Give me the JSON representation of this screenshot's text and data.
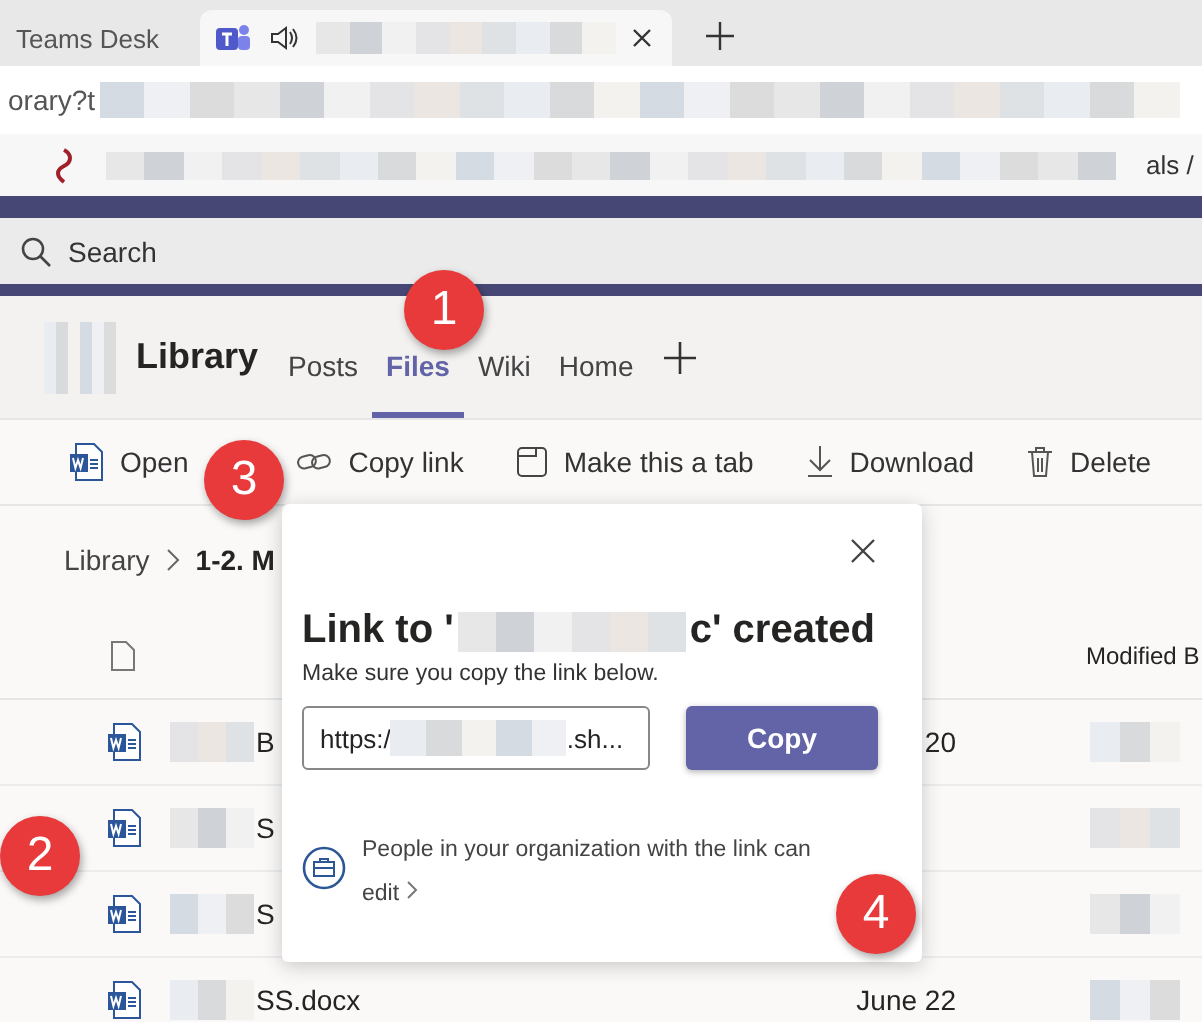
{
  "browser": {
    "tabs": [
      {
        "title": "Teams Desk",
        "selected": false,
        "audio": false
      },
      {
        "selected": true,
        "audio": true
      }
    ],
    "address": "orary?t",
    "bookmarks_tail": "als /"
  },
  "search": {
    "placeholder": "Search"
  },
  "team": {
    "name": "Library",
    "tabs": [
      {
        "label": "Posts",
        "selected": false
      },
      {
        "label": "Files",
        "selected": true
      },
      {
        "label": "Wiki",
        "selected": false
      },
      {
        "label": "Home",
        "selected": false
      }
    ]
  },
  "toolbar": [
    {
      "kind": "open",
      "label": "Open"
    },
    {
      "kind": "copy_link",
      "label": "Copy link"
    },
    {
      "kind": "make_tab",
      "label": "Make this a tab"
    },
    {
      "kind": "download",
      "label": "Download"
    },
    {
      "kind": "delete",
      "label": "Delete"
    }
  ],
  "breadcrumb": [
    "Library",
    "1-2. M"
  ],
  "table": {
    "column_modified_by": "Modified B",
    "rows": [
      {
        "name": "B",
        "modified": "20"
      },
      {
        "name": "S"
      },
      {
        "name": "S"
      },
      {
        "name": "SS.docx",
        "modified": "June 22"
      }
    ]
  },
  "dialog": {
    "title_start": "Link to '",
    "title_end": "c' created",
    "subtitle": "Make sure you copy the link below.",
    "link_start": "https:/",
    "link_end": ".sh...",
    "button": "Copy",
    "permission": "People in your organization with the link can edit"
  },
  "annotations": [
    {
      "number": "1"
    },
    {
      "number": "2"
    },
    {
      "number": "3"
    },
    {
      "number": "4"
    }
  ]
}
